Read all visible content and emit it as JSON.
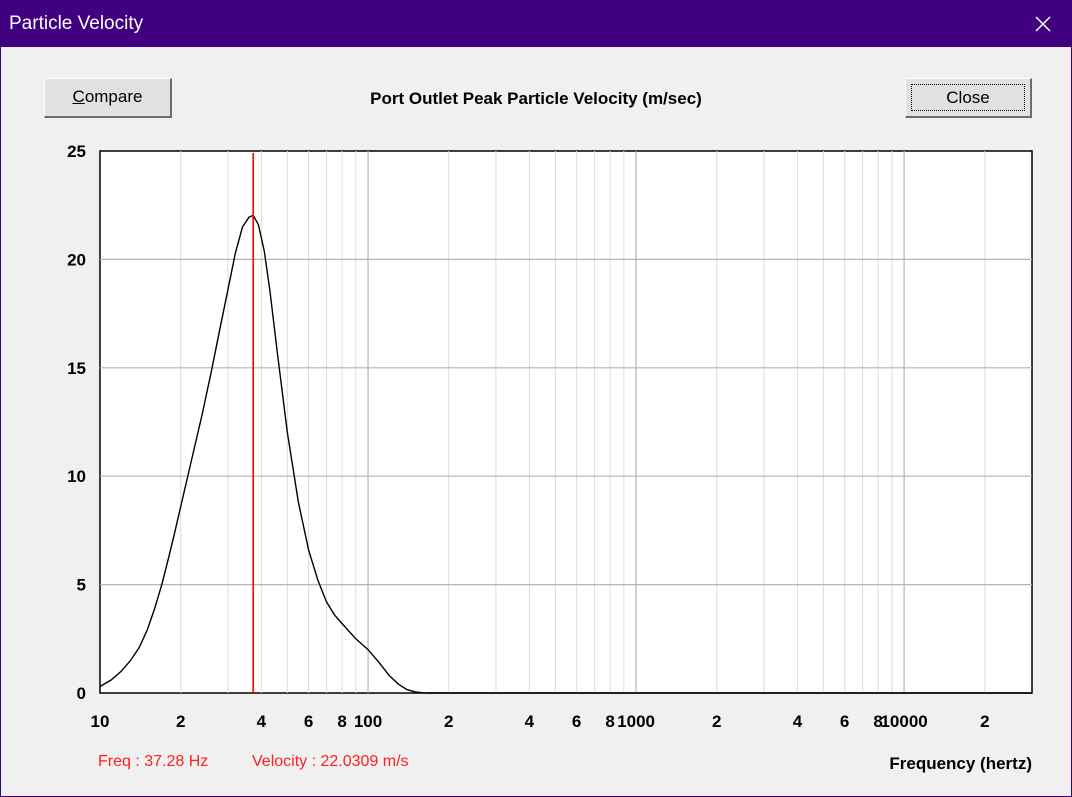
{
  "window": {
    "title": "Particle Velocity"
  },
  "toolbar": {
    "compare_label": "Compare",
    "close_label": "Close"
  },
  "status": {
    "freq": "Freq : 37.28 Hz",
    "velocity": "Velocity : 22.0309 m/s"
  },
  "colors": {
    "titlebar": "#410080",
    "curve": "#000000",
    "cursor": "#ff0000",
    "status_text": "#ff1f1f",
    "grid": "#c8c8c8"
  },
  "chart_data": {
    "type": "line",
    "title": "Port Outlet Peak Particle Velocity (m/sec)",
    "xlabel": "Frequency (hertz)",
    "ylabel": "",
    "x_scale": "log",
    "xlim": [
      10,
      30000
    ],
    "ylim": [
      0,
      25
    ],
    "grid": true,
    "yticks": [
      0,
      5,
      10,
      15,
      20,
      25
    ],
    "ytick_labels": [
      "0",
      "5",
      "10",
      "15",
      "20",
      "25"
    ],
    "xtick_labels": [
      {
        "value": 10,
        "label": "10"
      },
      {
        "value": 20,
        "label": "2"
      },
      {
        "value": 40,
        "label": "4"
      },
      {
        "value": 60,
        "label": "6"
      },
      {
        "value": 80,
        "label": "8"
      },
      {
        "value": 100,
        "label": "100"
      },
      {
        "value": 200,
        "label": "2"
      },
      {
        "value": 400,
        "label": "4"
      },
      {
        "value": 600,
        "label": "6"
      },
      {
        "value": 800,
        "label": "8"
      },
      {
        "value": 1000,
        "label": "1000"
      },
      {
        "value": 2000,
        "label": "2"
      },
      {
        "value": 4000,
        "label": "4"
      },
      {
        "value": 6000,
        "label": "6"
      },
      {
        "value": 8000,
        "label": "8"
      },
      {
        "value": 10000,
        "label": "10000"
      },
      {
        "value": 20000,
        "label": "2"
      }
    ],
    "series": [
      {
        "x": [
          10,
          11,
          12,
          13,
          14,
          15,
          16,
          17,
          18,
          19,
          20,
          22,
          24,
          26,
          28,
          30,
          32,
          34,
          36,
          37.28,
          39,
          41,
          43,
          46,
          50,
          55,
          60,
          65,
          70,
          75,
          80,
          90,
          100,
          110,
          120,
          130,
          140,
          150,
          160,
          170,
          500,
          30000
        ],
        "y": [
          0.3,
          0.6,
          1.0,
          1.5,
          2.1,
          2.9,
          3.9,
          5.0,
          6.2,
          7.4,
          8.6,
          10.8,
          12.8,
          14.8,
          16.8,
          18.6,
          20.3,
          21.5,
          21.95,
          22.03,
          21.6,
          20.4,
          18.6,
          15.6,
          12.0,
          8.8,
          6.6,
          5.2,
          4.2,
          3.6,
          3.2,
          2.5,
          2.0,
          1.4,
          0.8,
          0.4,
          0.15,
          0.05,
          0.01,
          0.0,
          0.0,
          0.0
        ]
      }
    ],
    "cursor": {
      "x": 37.28
    }
  }
}
